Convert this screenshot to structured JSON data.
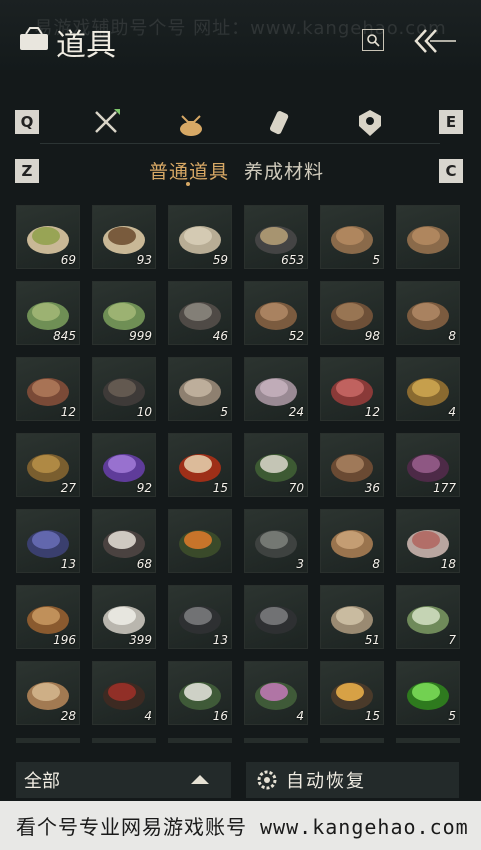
{
  "watermark_top": "易游戏辅助号个号 网址：www.kangehao.com",
  "header": {
    "title": "道具",
    "icons": [
      "bag-icon",
      "search-icon",
      "double-chevron-back-icon"
    ]
  },
  "category_row": {
    "key_left": "Q",
    "key_right": "E",
    "categories": [
      "crossed-swords-icon",
      "pouch-icon",
      "scroll-icon",
      "badge-icon"
    ],
    "active_index": 1
  },
  "sub_tabs": {
    "key_left": "Z",
    "key_right": "C",
    "tabs": [
      "普通道具",
      "养成材料"
    ],
    "active_index": 0
  },
  "items": [
    {
      "icon": "herb-powder-icon",
      "qty": "69"
    },
    {
      "icon": "worm-icon",
      "qty": "93"
    },
    {
      "icon": "sack-icon",
      "qty": "59"
    },
    {
      "icon": "arrow-icon",
      "qty": "653"
    },
    {
      "icon": "log-bundle-icon",
      "qty": "5"
    },
    {
      "icon": "log-bundle-icon",
      "qty": ""
    },
    {
      "icon": "bamboo-icon",
      "qty": "845"
    },
    {
      "icon": "bamboo-icon",
      "qty": "999"
    },
    {
      "icon": "dark-logs-icon",
      "qty": "46"
    },
    {
      "icon": "logs-icon",
      "qty": "52"
    },
    {
      "icon": "branches-icon",
      "qty": "98"
    },
    {
      "icon": "logs-icon",
      "qty": "8"
    },
    {
      "icon": "red-logs-icon",
      "qty": "12"
    },
    {
      "icon": "feather-icon",
      "qty": "10"
    },
    {
      "icon": "hide-icon",
      "qty": "5"
    },
    {
      "icon": "fur-icon",
      "qty": "24"
    },
    {
      "icon": "meat-icon",
      "qty": "12"
    },
    {
      "icon": "fish-icon",
      "qty": "4"
    },
    {
      "icon": "ore-pile-icon",
      "qty": "27"
    },
    {
      "icon": "purple-crystal-icon",
      "qty": "92"
    },
    {
      "icon": "red-stone-icon",
      "qty": "15"
    },
    {
      "icon": "white-herb-icon",
      "qty": "70"
    },
    {
      "icon": "mortar-icon",
      "qty": "36"
    },
    {
      "icon": "purple-flower-icon",
      "qty": "177"
    },
    {
      "icon": "lavender-icon",
      "qty": "13"
    },
    {
      "icon": "white-blossom-icon",
      "qty": "68"
    },
    {
      "icon": "orange-flower-icon",
      "qty": ""
    },
    {
      "icon": "dry-grass-icon",
      "qty": "3"
    },
    {
      "icon": "soup-bowl-icon",
      "qty": "8"
    },
    {
      "icon": "meat-slices-icon",
      "qty": "18"
    },
    {
      "icon": "pelt-icon",
      "qty": "196"
    },
    {
      "icon": "white-pelt-icon",
      "qty": "399"
    },
    {
      "icon": "dark-ore-icon",
      "qty": "13"
    },
    {
      "icon": "dark-ore-icon",
      "qty": ""
    },
    {
      "icon": "antler-icon",
      "qty": "51"
    },
    {
      "icon": "green-gourd-icon",
      "qty": "7"
    },
    {
      "icon": "rice-sack-icon",
      "qty": "28"
    },
    {
      "icon": "red-berry-icon",
      "qty": "4"
    },
    {
      "icon": "white-flower-icon",
      "qty": "16"
    },
    {
      "icon": "pink-flower-icon",
      "qty": "4"
    },
    {
      "icon": "torch-icon",
      "qty": "15"
    },
    {
      "icon": "green-orb-icon",
      "qty": "5"
    }
  ],
  "bottom": {
    "filter_label": "全部",
    "restore_label": "自动恢复"
  },
  "footer": {
    "text": "看个号专业网易游戏账号 www.kangehao.com"
  },
  "colors": {
    "accent": "#d7a865",
    "background": "#14191a"
  }
}
